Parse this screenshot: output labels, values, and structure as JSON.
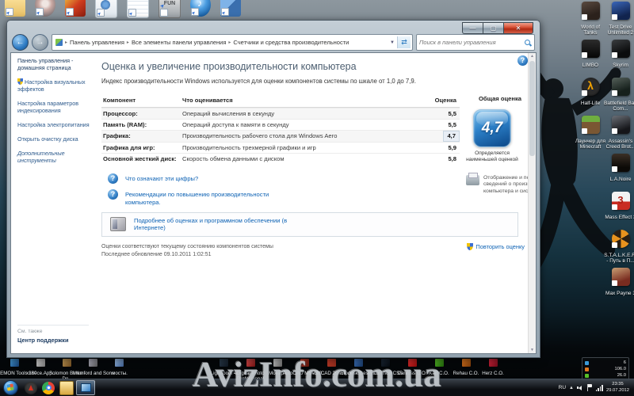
{
  "window": {
    "breadcrumb": [
      "Панель управления",
      "Все элементы панели управления",
      "Счетчики и средства производительности"
    ],
    "search_placeholder": "Поиск в панели управления",
    "sidebar": {
      "items": [
        "Панель управления - домашняя страница",
        "Настройка визуальных эффектов",
        "Настройка параметров индексирования",
        "Настройка электропитания",
        "Открыть очистку диска",
        "Дополнительные инструменты"
      ],
      "see_also": "См. также",
      "support_link": "Центр поддержки"
    },
    "main": {
      "title": "Оценка и увеличение производительности компьютера",
      "intro": "Индекс производительности Windows используется для оценки компонентов системы по шкале от 1,0 до 7,9.",
      "table": {
        "headers": [
          "Компонент",
          "Что оценивается",
          "Оценка",
          "Общая оценка"
        ],
        "rows": [
          {
            "component": "Процессор:",
            "measure": "Операций вычисления в секунду",
            "score": "5,5"
          },
          {
            "component": "Память (RAM):",
            "measure": "Операций доступа к памяти в секунду",
            "score": "5,5"
          },
          {
            "component": "Графика:",
            "measure": "Производительность рабочего стола для Windows Aero",
            "score": "4,7"
          },
          {
            "component": "Графика для игр:",
            "measure": "Производительность трехмерной графики и игр",
            "score": "5,9"
          },
          {
            "component": "Основной жесткий диск:",
            "measure": "Скорость обмена данными с диском",
            "score": "5,8"
          }
        ]
      },
      "badge": {
        "value": "4,7",
        "caption": "Определяется наименьшей оценкой"
      },
      "links": [
        "Что означают эти цифры?",
        "Рекомендации по повышению производительности компьютера."
      ],
      "print_note": "Отображение и печать подробных сведений о производительности компьютера и системе",
      "more_info": "Подробнее об оценках и программном обеспечении (в Интернете)",
      "status1": "Оценки соответствуют текущему состоянию компонентов системы",
      "status2": "Последнее обновление 09.10.2011 1:02:51",
      "rerun": "Повторить оценку"
    },
    "accent_colors": {
      "badge_blue": "#2c80c8",
      "link_blue": "#0d62b4",
      "close_red": "#b02a12"
    }
  },
  "desktop": {
    "top_icons": {
      "fun_label": "FUN"
    },
    "right_icons_col1": [
      {
        "label": "World of Tanks"
      },
      {
        "label": "LIMBO"
      },
      {
        "label": "Half-Life"
      },
      {
        "label": "Лаунчер для Minecraft"
      }
    ],
    "right_icons_col2": [
      {
        "label": "Test Drive Unlimited 2"
      },
      {
        "label": "Skyrim"
      },
      {
        "label": "Battlefield Bad Com..."
      },
      {
        "label": "Assassin's Creed Brot..."
      },
      {
        "label": "L.A.Noire"
      },
      {
        "label": "Mass Effect 3"
      },
      {
        "label": "S.T.A.L.K.E.R. - Путь в П..."
      },
      {
        "label": "Max Payne 3"
      }
    ],
    "bottom_labels": [
      "DAEMON Tools Lite",
      "x360ce.App...",
      "Solomon Burke - Do...",
      "Mumford and Sons ...",
      "мосты.",
      "Lightroom 4",
      "Digital Photo Professional",
      "Монарх",
      "AutoCAD MEP 20...",
      "AutoCAD 2005 - ...",
      "Autodesk Design...",
      "Photoshop CS5",
      "Danfoss C.O.",
      "Kan C.O.",
      "Rehau C.O.",
      "Herz C.O."
    ],
    "watermark": "AvizInfo.com.ua"
  },
  "gadget": {
    "rows": [
      {
        "value": "6"
      },
      {
        "value": "106.0"
      },
      {
        "value": "26.0"
      }
    ]
  },
  "taskbar": {
    "tray": {
      "language": "RU",
      "time": "23:35",
      "date": "29.07.2012"
    }
  }
}
